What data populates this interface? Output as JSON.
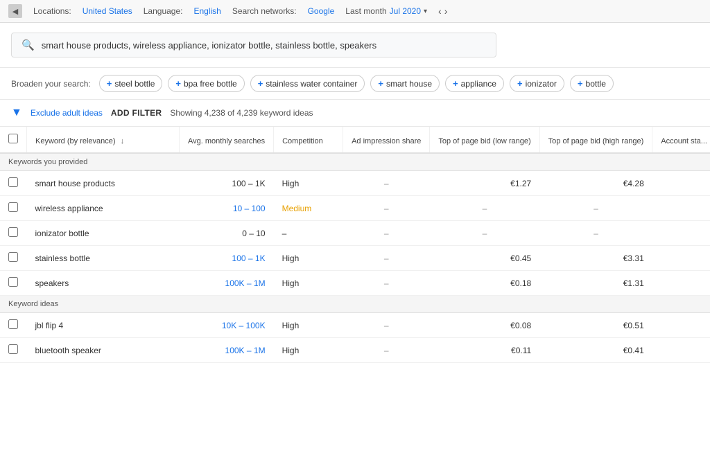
{
  "topbar": {
    "location_label": "Locations:",
    "location_value": "United States",
    "language_label": "Language:",
    "language_value": "English",
    "search_networks_label": "Search networks:",
    "search_networks_value": "Google",
    "last_month_label": "Last month",
    "date_value": "Jul 2020"
  },
  "search": {
    "placeholder": "smart house products, wireless appliance, ionizator bottle, stainless bottle, speakers",
    "value": "smart house products, wireless appliance, ionizator bottle, stainless bottle, speakers"
  },
  "broaden": {
    "label": "Broaden your search:",
    "chips": [
      "steel bottle",
      "bpa free bottle",
      "stainless water container",
      "smart house",
      "appliance",
      "ionizator",
      "bottle"
    ]
  },
  "filter": {
    "exclude_label": "Exclude adult ideas",
    "add_filter_label": "ADD FILTER",
    "showing_text": "Showing 4,238 of 4,239 keyword ideas"
  },
  "table": {
    "headers": {
      "keyword": "Keyword (by relevance)",
      "avg_monthly": "Avg. monthly searches",
      "competition": "Competition",
      "ad_impression": "Ad impression share",
      "top_bid_low": "Top of page bid (low range)",
      "top_bid_high": "Top of page bid (high range)",
      "account_status": "Account sta..."
    },
    "sections": [
      {
        "section_label": "Keywords you provided",
        "rows": [
          {
            "keyword": "smart house products",
            "avg_monthly": "100 – 1K",
            "avg_monthly_type": "plain",
            "competition": "High",
            "competition_type": "high",
            "ad_impression": "–",
            "top_bid_low": "€1.27",
            "top_bid_high": "€4.28"
          },
          {
            "keyword": "wireless appliance",
            "avg_monthly": "10 – 100",
            "avg_monthly_type": "blue",
            "competition": "Medium",
            "competition_type": "medium",
            "ad_impression": "–",
            "top_bid_low": "–",
            "top_bid_high": "–"
          },
          {
            "keyword": "ionizator bottle",
            "avg_monthly": "0 – 10",
            "avg_monthly_type": "plain",
            "competition": "–",
            "competition_type": "dash",
            "ad_impression": "–",
            "top_bid_low": "–",
            "top_bid_high": "–"
          },
          {
            "keyword": "stainless bottle",
            "avg_monthly": "100 – 1K",
            "avg_monthly_type": "blue",
            "competition": "High",
            "competition_type": "high",
            "ad_impression": "–",
            "top_bid_low": "€0.45",
            "top_bid_high": "€3.31"
          },
          {
            "keyword": "speakers",
            "avg_monthly": "100K – 1M",
            "avg_monthly_type": "blue",
            "competition": "High",
            "competition_type": "high",
            "ad_impression": "–",
            "top_bid_low": "€0.18",
            "top_bid_high": "€1.31"
          }
        ]
      },
      {
        "section_label": "Keyword ideas",
        "rows": [
          {
            "keyword": "jbl flip 4",
            "avg_monthly": "10K – 100K",
            "avg_monthly_type": "blue",
            "competition": "High",
            "competition_type": "high",
            "ad_impression": "–",
            "top_bid_low": "€0.08",
            "top_bid_high": "€0.51"
          },
          {
            "keyword": "bluetooth speaker",
            "avg_monthly": "100K – 1M",
            "avg_monthly_type": "blue",
            "competition": "High",
            "competition_type": "high",
            "ad_impression": "–",
            "top_bid_low": "€0.11",
            "top_bid_high": "€0.41"
          }
        ]
      }
    ]
  }
}
